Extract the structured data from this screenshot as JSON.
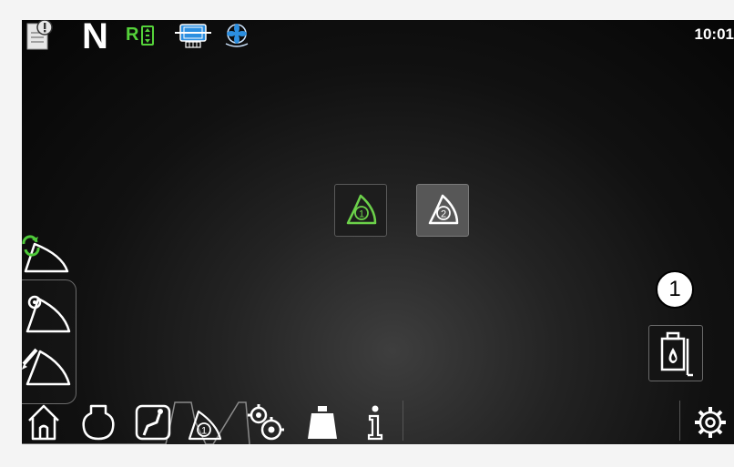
{
  "status_bar": {
    "gear": "N",
    "range": "R",
    "clock": "10:01",
    "icons": [
      "document-info-icon",
      "range-selector-icon",
      "axle-lock-icon",
      "fan-icon"
    ]
  },
  "center": {
    "tiles": [
      {
        "number": "1",
        "icon": "bucket-1-icon",
        "color": "#6cd14a",
        "selected": true
      },
      {
        "number": "2",
        "icon": "bucket-2-icon",
        "color": "#ffffff",
        "selected": false
      }
    ]
  },
  "left_panel": {
    "items": [
      {
        "icon": "bucket-refresh-icon"
      },
      {
        "icon": "bucket-settings-icon"
      },
      {
        "icon": "bucket-edit-icon"
      }
    ]
  },
  "marker": {
    "label": "1"
  },
  "oil_button": {
    "icon": "oil-container-icon"
  },
  "bottom_nav": {
    "items": [
      {
        "icon": "home-icon"
      },
      {
        "icon": "engine-icon"
      },
      {
        "icon": "route-icon"
      },
      {
        "icon": "bucket-tab-icon",
        "number": "1",
        "active": true
      },
      {
        "icon": "gears-icon"
      },
      {
        "icon": "weight-icon"
      },
      {
        "icon": "info-icon"
      },
      {
        "icon": "settings-icon"
      }
    ]
  },
  "colors": {
    "accent": "#6cd14a",
    "status_blue": "#2c8fe0",
    "background": "#0a0a0a"
  }
}
